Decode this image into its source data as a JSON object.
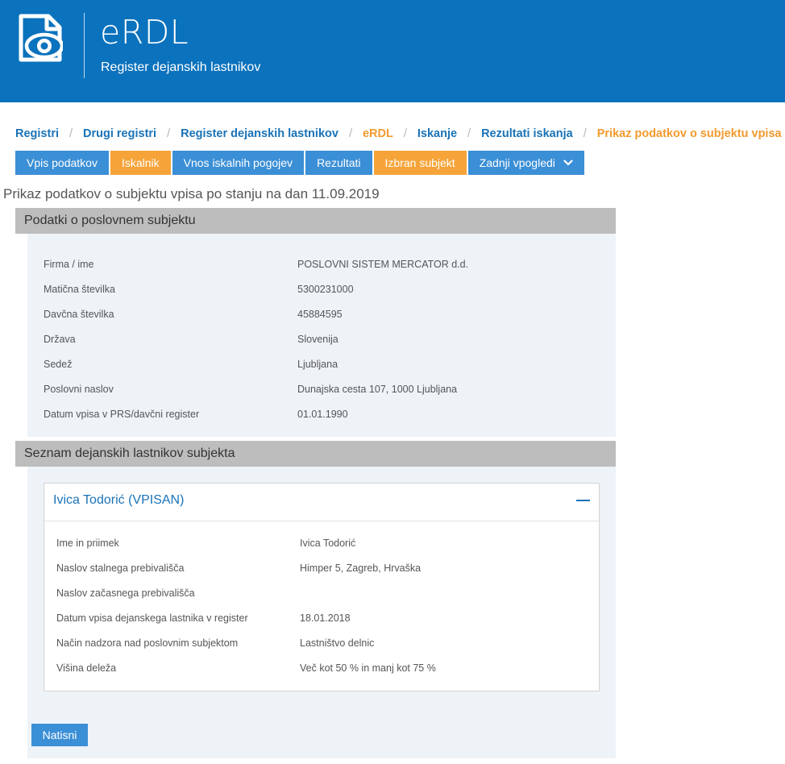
{
  "header": {
    "app_name": "eRDL",
    "subtitle": "Register dejanskih lastnikov",
    "logo_icon": "document-eye-icon"
  },
  "breadcrumb": [
    {
      "label": "Registri",
      "accent": false
    },
    {
      "label": "Drugi registri",
      "accent": false
    },
    {
      "label": "Register dejanskih lastnikov",
      "accent": false
    },
    {
      "label": "eRDL",
      "accent": true
    },
    {
      "label": "Iskanje",
      "accent": false
    },
    {
      "label": "Rezultati iskanja",
      "accent": false
    },
    {
      "label": "Prikaz podatkov o subjektu vpisa",
      "accent": true
    }
  ],
  "breadcrumb_separator": "/",
  "tabs": [
    {
      "label": "Vpis podatkov",
      "color": "blue"
    },
    {
      "label": "Iskalnik",
      "color": "orange"
    },
    {
      "label": "Vnos iskalnih pogojev",
      "color": "blue"
    },
    {
      "label": "Rezultati",
      "color": "blue"
    },
    {
      "label": "Izbran subjekt",
      "color": "orange"
    },
    {
      "label": "Zadnji vpogledi",
      "color": "blue",
      "dropdown": true
    }
  ],
  "page_heading": "Prikaz podatkov o subjektu vpisa po stanju na dan 11.09.2019",
  "business_section": {
    "title": "Podatki o poslovnem subjektu",
    "fields": [
      {
        "label": "Firma / ime",
        "value": "POSLOVNI SISTEM MERCATOR d.d."
      },
      {
        "label": "Matična številka",
        "value": "5300231000"
      },
      {
        "label": "Davčna številka",
        "value": "45884595"
      },
      {
        "label": "Država",
        "value": "Slovenija"
      },
      {
        "label": "Sedež",
        "value": "Ljubljana"
      },
      {
        "label": "Poslovni naslov",
        "value": "Dunajska cesta 107, 1000 Ljubljana"
      },
      {
        "label": "Datum vpisa v PRS/davčni register",
        "value": "01.01.1990"
      }
    ]
  },
  "owners_section": {
    "title": "Seznam dejanskih lastnikov subjekta",
    "owner": {
      "title": "Ivica Todorić (VPISAN)",
      "collapse_icon": "minus-icon",
      "fields": [
        {
          "label": "Ime in priimek",
          "value": "Ivica Todorić"
        },
        {
          "label": "Naslov stalnega prebivališča",
          "value": "Himper 5, Zagreb, Hrvaška"
        },
        {
          "label": "Naslov začasnega prebivališča",
          "value": ""
        },
        {
          "label": "Datum vpisa dejanskega lastnika v register",
          "value": "18.01.2018"
        },
        {
          "label": "Način nadzora nad poslovnim subjektom",
          "value": "Lastništvo delnic"
        },
        {
          "label": "Višina deleža",
          "value": "Več kot 50 % in manj kot 75 %"
        }
      ]
    }
  },
  "print_button": "Natisni",
  "colors": {
    "header_blue": "#0b72bd",
    "link_blue": "#1a73b8",
    "tab_blue": "#3b8fd6",
    "accent_orange": "#f6a43a",
    "section_gray": "#bdbdbd",
    "panel_bg": "#eef3f8"
  }
}
